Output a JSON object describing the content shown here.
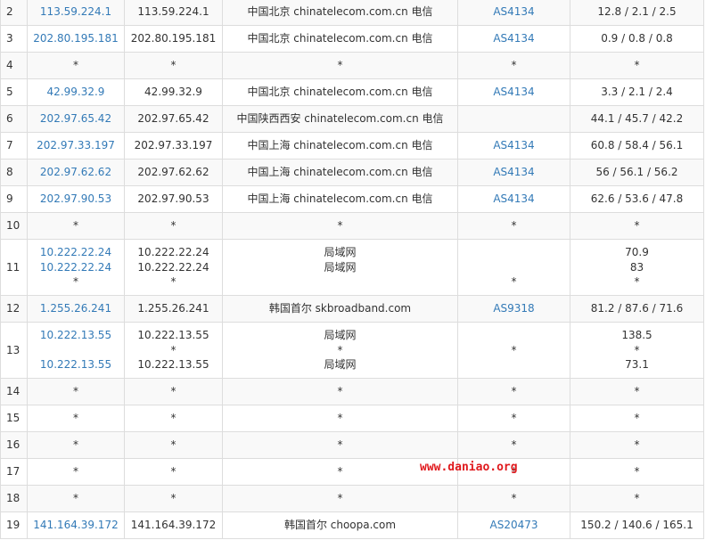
{
  "rows": [
    {
      "no": "2",
      "ip": [
        "113.59.224.1"
      ],
      "host": [
        "113.59.224.1"
      ],
      "loc": [
        "中国北京 chinatelecom.com.cn 电信"
      ],
      "asn": [
        "AS4134"
      ],
      "time": [
        "12.8 / 2.1 / 2.5"
      ]
    },
    {
      "no": "3",
      "ip": [
        "202.80.195.181"
      ],
      "host": [
        "202.80.195.181"
      ],
      "loc": [
        "中国北京 chinatelecom.com.cn 电信"
      ],
      "asn": [
        "AS4134"
      ],
      "time": [
        "0.9 / 0.8 / 0.8"
      ]
    },
    {
      "no": "4",
      "ip": [
        "*"
      ],
      "host": [
        "*"
      ],
      "loc": [
        "*"
      ],
      "asn": [
        "*"
      ],
      "time": [
        "*"
      ]
    },
    {
      "no": "5",
      "ip": [
        "42.99.32.9"
      ],
      "host": [
        "42.99.32.9"
      ],
      "loc": [
        "中国北京 chinatelecom.com.cn 电信"
      ],
      "asn": [
        "AS4134"
      ],
      "time": [
        "3.3 / 2.1 / 2.4"
      ]
    },
    {
      "no": "6",
      "ip": [
        "202.97.65.42"
      ],
      "host": [
        "202.97.65.42"
      ],
      "loc": [
        "中国陕西西安 chinatelecom.com.cn 电信"
      ],
      "asn": [
        ""
      ],
      "time": [
        "44.1 / 45.7 / 42.2"
      ]
    },
    {
      "no": "7",
      "ip": [
        "202.97.33.197"
      ],
      "host": [
        "202.97.33.197"
      ],
      "loc": [
        "中国上海 chinatelecom.com.cn 电信"
      ],
      "asn": [
        "AS4134"
      ],
      "time": [
        "60.8 / 58.4 / 56.1"
      ]
    },
    {
      "no": "8",
      "ip": [
        "202.97.62.62"
      ],
      "host": [
        "202.97.62.62"
      ],
      "loc": [
        "中国上海 chinatelecom.com.cn 电信"
      ],
      "asn": [
        "AS4134"
      ],
      "time": [
        "56 / 56.1 / 56.2"
      ]
    },
    {
      "no": "9",
      "ip": [
        "202.97.90.53"
      ],
      "host": [
        "202.97.90.53"
      ],
      "loc": [
        "中国上海 chinatelecom.com.cn 电信"
      ],
      "asn": [
        "AS4134"
      ],
      "time": [
        "62.6 / 53.6 / 47.8"
      ]
    },
    {
      "no": "10",
      "ip": [
        "*"
      ],
      "host": [
        "*"
      ],
      "loc": [
        "*"
      ],
      "asn": [
        "*"
      ],
      "time": [
        "*"
      ]
    },
    {
      "no": "11",
      "ip": [
        "10.222.22.24",
        "10.222.22.24",
        "*"
      ],
      "host": [
        "10.222.22.24",
        "10.222.22.24",
        "*"
      ],
      "loc": [
        "局域网",
        "局域网",
        ""
      ],
      "asn": [
        "",
        "",
        "*"
      ],
      "time": [
        "70.9",
        "83",
        "*"
      ]
    },
    {
      "no": "12",
      "ip": [
        "1.255.26.241"
      ],
      "host": [
        "1.255.26.241"
      ],
      "loc": [
        "韩国首尔 skbroadband.com"
      ],
      "asn": [
        "AS9318"
      ],
      "time": [
        "81.2 / 87.6 / 71.6"
      ]
    },
    {
      "no": "13",
      "ip": [
        "10.222.13.55",
        "",
        "10.222.13.55"
      ],
      "host": [
        "10.222.13.55",
        "*",
        "10.222.13.55"
      ],
      "loc": [
        "局域网",
        "*",
        "局域网"
      ],
      "asn": [
        "*"
      ],
      "time": [
        "138.5",
        "*",
        "73.1"
      ]
    },
    {
      "no": "14",
      "ip": [
        "*"
      ],
      "host": [
        "*"
      ],
      "loc": [
        "*"
      ],
      "asn": [
        "*"
      ],
      "time": [
        "*"
      ]
    },
    {
      "no": "15",
      "ip": [
        "*"
      ],
      "host": [
        "*"
      ],
      "loc": [
        "*"
      ],
      "asn": [
        "*"
      ],
      "time": [
        "*"
      ]
    },
    {
      "no": "16",
      "ip": [
        "*"
      ],
      "host": [
        "*"
      ],
      "loc": [
        "*"
      ],
      "asn": [
        "*"
      ],
      "time": [
        "*"
      ]
    },
    {
      "no": "17",
      "ip": [
        "*"
      ],
      "host": [
        "*"
      ],
      "loc": [
        "*"
      ],
      "asn": [
        "*"
      ],
      "time": [
        "*"
      ]
    },
    {
      "no": "18",
      "ip": [
        "*"
      ],
      "host": [
        "*"
      ],
      "loc": [
        "*"
      ],
      "asn": [
        "*"
      ],
      "time": [
        "*"
      ]
    },
    {
      "no": "19",
      "ip": [
        "141.164.39.172"
      ],
      "host": [
        "141.164.39.172"
      ],
      "loc": [
        "韩国首尔 choopa.com"
      ],
      "asn": [
        "AS20473"
      ],
      "time": [
        "150.2 / 140.6 / 165.1"
      ]
    }
  ],
  "watermark": "www.daniao.org",
  "colors": {
    "link": "#337ab7",
    "text": "#333333",
    "watermark": "#e0191d",
    "border": "#dddddd",
    "stripe": "#f9f9f9"
  }
}
